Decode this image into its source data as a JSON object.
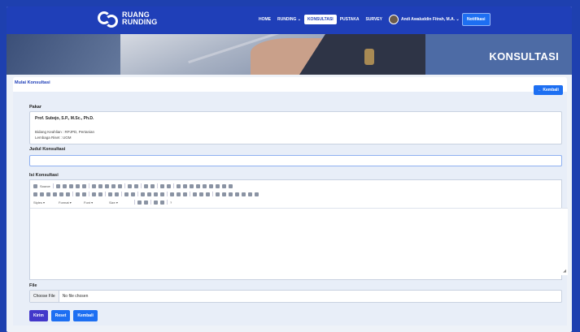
{
  "navbar": {
    "logo_line1": "RUANG",
    "logo_line2": "RUNDING",
    "items": [
      "HOME",
      "RUNDING",
      "KONSULTASI",
      "PUSTAKA",
      "SURVEY"
    ],
    "runding_caret": "⌄",
    "user_name": "Andi Awaluddin Fitrah, M.A.",
    "user_caret": "⌄",
    "notif_label": "Notifikasi"
  },
  "hero": {
    "title": "KONSULTASI"
  },
  "card": {
    "title": "Mulai Konsultasi",
    "back_button": "← Kembali",
    "pakar_label": "Pakar",
    "pakar_name": "Prof. Subejo, S.P., M.Sc., Ph.D.",
    "pakar_bidang": "Bidang Keahlian : RPJPD, Pertanian",
    "pakar_lembaga": "Lembaga Riset : UGM",
    "judul_label": "Judul Konsultasi",
    "judul_value": "",
    "isi_label": "Isi Konsultasi",
    "file_label": "File",
    "file_button": "Choose File",
    "file_status": "No file chosen",
    "actions": {
      "kirim": "Kirim",
      "reset": "Reset",
      "kembali": "Kembali"
    }
  },
  "editor": {
    "toolbar_row1": [
      "Source"
    ],
    "dropdowns": [
      "Styles",
      "Format",
      "Font",
      "Size"
    ],
    "row3_extra": "?"
  }
}
